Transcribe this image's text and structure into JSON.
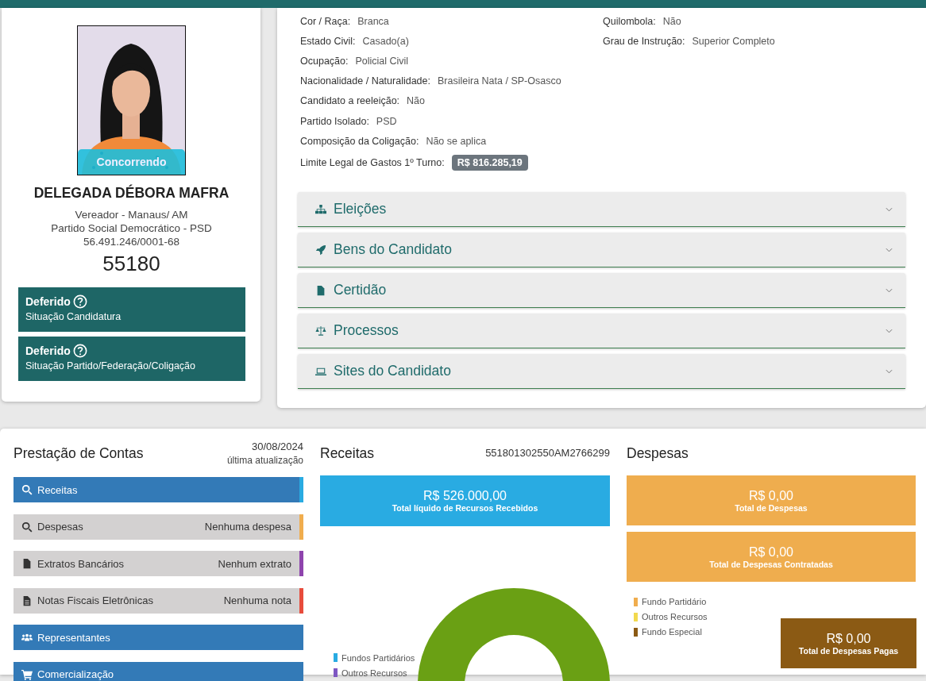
{
  "candidate": {
    "photo": {
      "kind": "picture",
      "badge": "Concorrendo"
    },
    "name": "DELEGADA DÉBORA MAFRA",
    "details": [
      "Vereador - Manaus/ AM",
      "Partido Social Democrático - PSD",
      "56.491.246/0001-68"
    ],
    "number": "55180",
    "statuses": [
      {
        "value": "Deferido",
        "label": "Situação Candidatura"
      },
      {
        "value": "Deferido",
        "label": "Situação Partido/Federação/Coligação"
      }
    ]
  },
  "info": {
    "left": [
      {
        "label": "Cor / Raça:",
        "value": "Branca"
      },
      {
        "label": "Estado Civil:",
        "value": "Casado(a)"
      },
      {
        "label": "Ocupação:",
        "value": "Policial Civil"
      },
      {
        "label": "Nacionalidade / Naturalidade:",
        "value": "Brasileira Nata / SP-Osasco"
      },
      {
        "label": "Candidato a reeleição:",
        "value": "Não"
      },
      {
        "label": "Partido Isolado:",
        "value": "PSD"
      },
      {
        "label": "Composição da Coligação:",
        "value": "Não se aplica"
      }
    ],
    "right": [
      {
        "label": "Quilombola:",
        "value": "Não"
      },
      {
        "label": "Grau de Instrução:",
        "value": "Superior Completo"
      }
    ],
    "limit": {
      "label": "Limite Legal de Gastos 1º Turno:",
      "value": "R$ 816.285,19"
    }
  },
  "accordion": [
    {
      "title": "Eleições",
      "expanded": false
    },
    {
      "title": "Bens do Candidato",
      "expanded": false
    },
    {
      "title": "Certidão",
      "expanded": false
    },
    {
      "title": "Processos",
      "expanded": false
    },
    {
      "title": "Sites do Candidato",
      "expanded": false
    }
  ],
  "accounts": {
    "title": "Prestação de Contas",
    "date": "30/08/2024",
    "date_label": "última atualização",
    "items": [
      {
        "label": "Receitas",
        "kind": "primary",
        "color": "#29abe2"
      },
      {
        "label": "Despesas",
        "kind": "secondary",
        "note": "Nenhuma despesa",
        "color": "#f0ad4e"
      },
      {
        "label": "Extratos Bancários",
        "kind": "secondary",
        "note": "Nenhum extrato",
        "color": "#8e44ad"
      },
      {
        "label": "Notas Fiscais Eletrônicas",
        "kind": "secondary",
        "note": "Nenhuma nota",
        "color": "#e74c3c"
      },
      {
        "label": "Representantes",
        "kind": "primary"
      },
      {
        "label": "Comercialização",
        "kind": "primary"
      }
    ]
  },
  "receitas": {
    "title": "Receitas",
    "code": "551801302550AM2766299",
    "total": {
      "amount": "R$ 526.000,00",
      "label": "Total líquido de Recursos Recebidos"
    },
    "legend": [
      {
        "label": "Fundos Partidários",
        "color": "#29abe2"
      },
      {
        "label": "Outros Recursos",
        "color": "#7e57c2"
      }
    ]
  },
  "despesas": {
    "title": "Despesas",
    "totals": [
      {
        "amount": "R$ 0,00",
        "label": "Total de Despesas"
      },
      {
        "amount": "R$ 0,00",
        "label": "Total de Despesas Contratadas"
      }
    ],
    "legend": [
      {
        "label": "Fundo Partidário",
        "color": "#f0ad4e"
      },
      {
        "label": "Outros Recursos",
        "color": "#f2d94e"
      },
      {
        "label": "Fundo Especial",
        "color": "#8b5a14"
      }
    ],
    "paid": {
      "amount": "R$ 0,00",
      "label": "Total de Despesas Pagas"
    }
  }
}
